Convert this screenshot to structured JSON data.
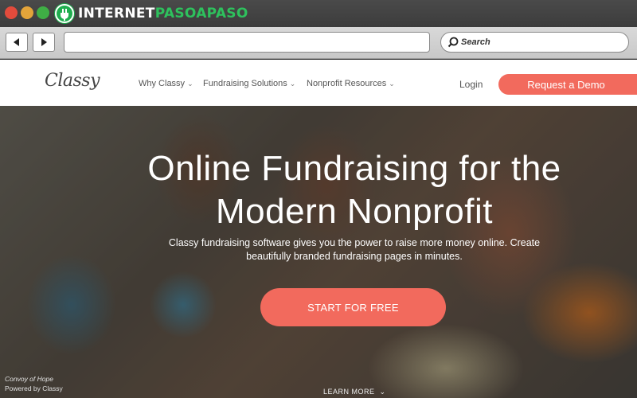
{
  "watermark": {
    "prefix": "INTERNET",
    "highlight": "PASOAPASO",
    "logo_icon": "power-plug-icon"
  },
  "browser": {
    "back_icon": "triangle-left-icon",
    "forward_icon": "triangle-right-icon",
    "address_value": "",
    "search_placeholder": "Search"
  },
  "site": {
    "logo": "Classy",
    "nav": [
      {
        "label": "Why Classy"
      },
      {
        "label": "Fundraising Solutions"
      },
      {
        "label": "Nonprofit Resources"
      }
    ],
    "login_label": "Login",
    "demo_label": "Request a Demo"
  },
  "hero": {
    "title_line1": "Online Fundraising for the",
    "title_line2": "Modern Nonprofit",
    "subtitle": "Classy fundraising software gives you the power to raise more money online. Create beautifully branded fundraising pages in minutes.",
    "cta_label": "START FOR FREE",
    "learn_more": "LEARN MORE",
    "credit_line1": "Convoy of Hope",
    "credit_line2": "Powered by Classy"
  },
  "colors": {
    "accent": "#f26a5d",
    "watermark_green": "#2ec15d"
  }
}
